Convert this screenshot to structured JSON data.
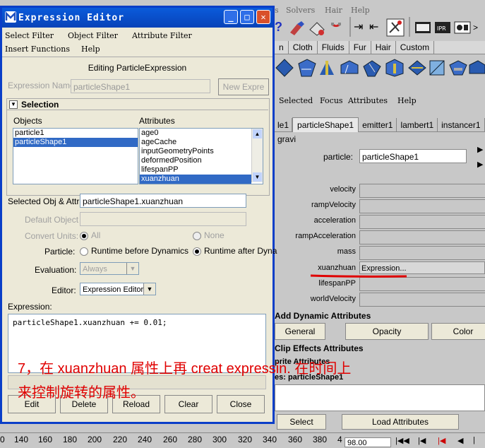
{
  "maya": {
    "menu": [
      "s",
      "Solvers",
      "Hair",
      "Help"
    ],
    "shelf_tabs": [
      "n",
      "Cloth",
      "Fluids",
      "Fur",
      "Hair",
      "Custom"
    ],
    "ae_menu": [
      "Selected",
      "Focus",
      "Attributes",
      "Help"
    ],
    "node_tabs": [
      "le1",
      "particleShape1",
      "emitter1",
      "lambert1",
      "instancer1",
      "gravi"
    ],
    "particle_label": "particle:",
    "particle_value": "particleShape1",
    "attrs": [
      {
        "label": "velocity",
        "value": ""
      },
      {
        "label": "rampVelocity",
        "value": ""
      },
      {
        "label": "acceleration",
        "value": ""
      },
      {
        "label": "rampAcceleration",
        "value": ""
      },
      {
        "label": "mass",
        "value": ""
      },
      {
        "label": "xuanzhuan",
        "value": "Expression..."
      },
      {
        "label": "lifespanPP",
        "value": ""
      },
      {
        "label": "worldVelocity",
        "value": ""
      }
    ],
    "add_dynamic_attributes": "Add Dynamic Attributes",
    "general_btn": "General",
    "opacity_btn": "Opacity",
    "color_btn": "Color",
    "clip_effects": "Clip Effects Attributes",
    "sprite_attrs": "prite Attributes",
    "notes": "es: particleShape1",
    "select_btn": "Select",
    "load_attrs_btn": "Load Attributes",
    "timeline": [
      "0",
      "140",
      "160",
      "180",
      "200",
      "220",
      "240",
      "260",
      "280",
      "300",
      "320",
      "340",
      "360",
      "380",
      "4"
    ],
    "current_time": "98.00"
  },
  "ee": {
    "title": "Expression Editor",
    "menu1": [
      "Select Filter",
      "Object Filter",
      "Attribute Filter"
    ],
    "menu2": [
      "Insert Functions",
      "Help"
    ],
    "heading": "Editing ParticleExpression",
    "expression_name_label": "Expression Name",
    "expression_name_value": "particleShape1",
    "new_expr_btn": "New Expre",
    "selection_label": "Selection",
    "objects_label": "Objects",
    "attributes_label": "Attributes",
    "objects": [
      {
        "name": "particle1",
        "selected": false
      },
      {
        "name": "particleShape1",
        "selected": true
      }
    ],
    "attributes": [
      {
        "name": "age0",
        "selected": false
      },
      {
        "name": "ageCache",
        "selected": false
      },
      {
        "name": "inputGeometryPoints",
        "selected": false
      },
      {
        "name": "deformedPosition",
        "selected": false
      },
      {
        "name": "lifespanPP",
        "selected": false
      },
      {
        "name": "xuanzhuan",
        "selected": true
      }
    ],
    "selected_obj_label": "Selected Obj & Attr",
    "selected_obj_value": "particleShape1.xuanzhuan",
    "default_object_label": "Default Object",
    "convert_units_label": "Convert Units:",
    "convert_all": "All",
    "convert_none": "None",
    "particle_label": "Particle:",
    "runtime_before": "Runtime before Dynamics",
    "runtime_after": "Runtime after Dyna",
    "evaluation_label": "Evaluation:",
    "evaluation_value": "Always",
    "editor_label": "Editor:",
    "editor_value": "Expression Editor",
    "expression_label": "Expression:",
    "expression_text": "particleShape1.xuanzhuan += 0.01;",
    "buttons": [
      "Edit",
      "Delete",
      "Reload",
      "Clear",
      "Close"
    ]
  },
  "annotation": {
    "line1": "7，在 xuanzhuan 属性上再 creat expressin. 在时间上",
    "line2": "来控制旋转的属性。"
  }
}
